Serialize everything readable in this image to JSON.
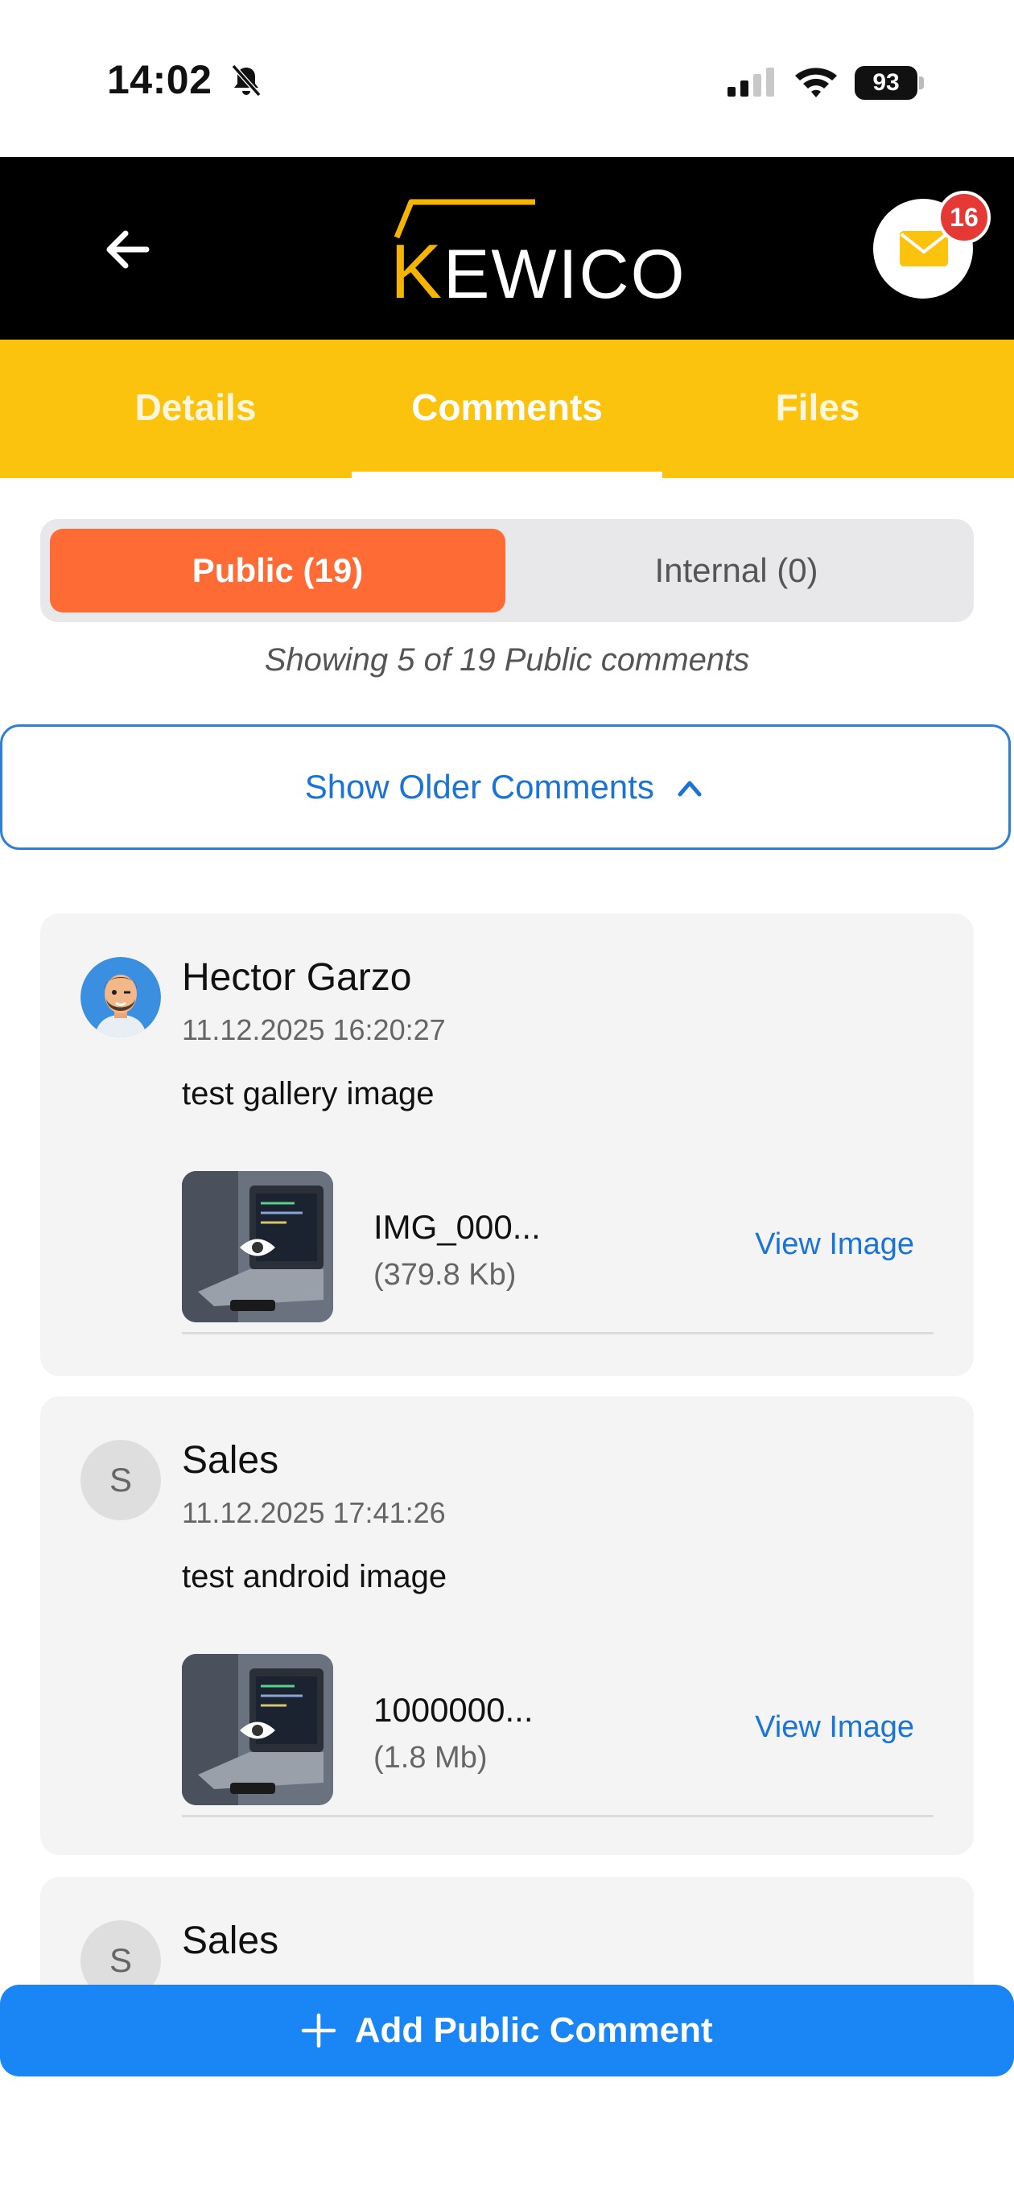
{
  "status_bar": {
    "time": "14:02",
    "battery": "93"
  },
  "header": {
    "logo_first": "K",
    "logo_rest": "EWICO",
    "mail_badge": "16",
    "brand_color": "#f5b400"
  },
  "tabs": [
    {
      "label": "Details"
    },
    {
      "label": "Comments"
    },
    {
      "label": "Files"
    }
  ],
  "segment": {
    "public_label": "Public (19)",
    "internal_label": "Internal (0)"
  },
  "showing_text": "Showing 5 of 19 Public comments",
  "older_button": "Show Older Comments",
  "comments": [
    {
      "author": "Hector Garzo",
      "timestamp": "11.12.2025 16:20:27",
      "text": "test gallery image",
      "attachment": {
        "name": "IMG_000...",
        "size": "(379.8 Kb)",
        "action": "View Image"
      }
    },
    {
      "author": "Sales",
      "avatar_letter": "S",
      "timestamp": "11.12.2025 17:41:26",
      "text": "test android image",
      "attachment": {
        "name": "1000000...",
        "size": "(1.8 Mb)",
        "action": "View Image"
      }
    },
    {
      "author": "Sales",
      "avatar_letter": "S"
    }
  ],
  "add_button": "Add Public Comment",
  "colors": {
    "tab_bar": "#fbc20e",
    "public_active": "#ff6b35",
    "link_blue": "#1a74d8",
    "add_button": "#1a86f5"
  }
}
